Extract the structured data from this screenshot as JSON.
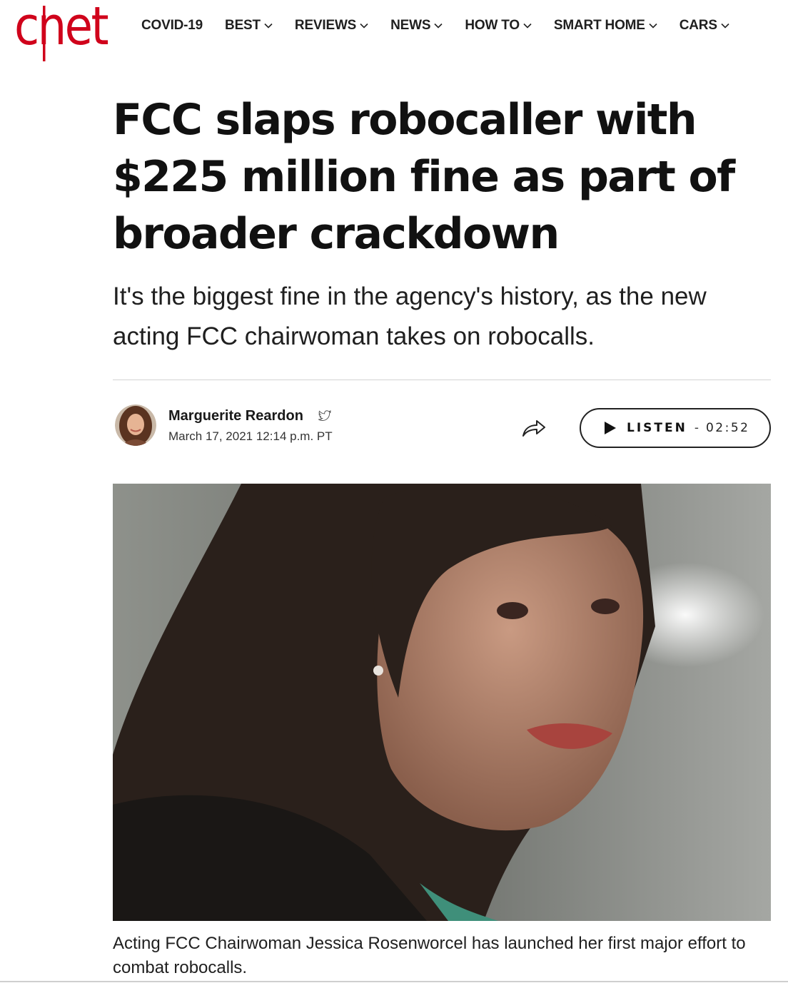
{
  "brand": {
    "logo_text": "cnet",
    "accent": "#d0021b"
  },
  "nav": {
    "items": [
      {
        "label": "COVID-19",
        "dropdown": false
      },
      {
        "label": "BEST",
        "dropdown": true
      },
      {
        "label": "REVIEWS",
        "dropdown": true
      },
      {
        "label": "NEWS",
        "dropdown": true
      },
      {
        "label": "HOW TO",
        "dropdown": true
      },
      {
        "label": "SMART HOME",
        "dropdown": true
      },
      {
        "label": "CARS",
        "dropdown": true
      }
    ]
  },
  "article": {
    "headline": "FCC slaps robocaller with $225 million fine as part of broader crackdown",
    "dek": "It's the biggest fine in the agency's history, as the new acting FCC chairwoman takes on robocalls.",
    "author": "Marguerite Reardon",
    "date": "March 17, 2021 12:14 p.m. PT",
    "listen": {
      "label": "LISTEN",
      "separator": "-",
      "duration": "02:52"
    },
    "hero_caption": "Acting FCC Chairwoman Jessica Rosenworcel has launched her first major effort to combat robocalls."
  },
  "icons": {
    "author_social": "twitter-icon",
    "share": "share-arrow-icon",
    "listen": "play-icon",
    "nav_dropdown": "chevron-down-icon"
  }
}
